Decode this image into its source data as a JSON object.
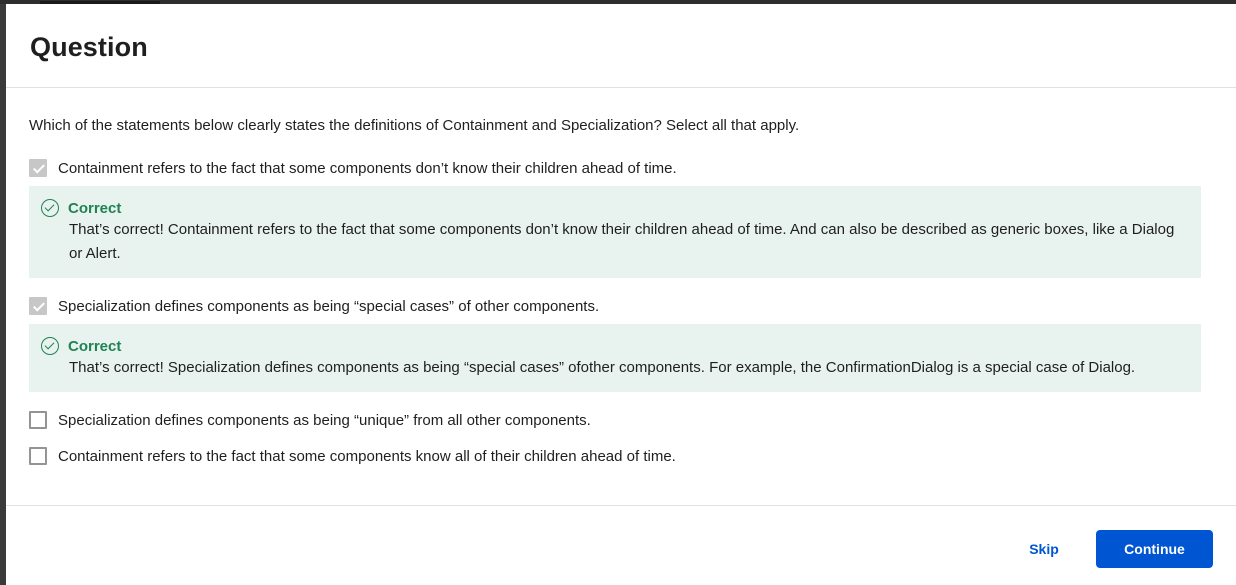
{
  "dialog": {
    "title": "Question",
    "prompt": "Which of the statements below clearly states the definitions of Containment and Specialization? Select all that apply.",
    "options": [
      {
        "label": "Containment refers to the fact that some components don’t know their children ahead of time.",
        "checked": true,
        "feedback": {
          "title": "Correct",
          "text": "That’s correct! Containment refers to the fact that some components don’t know their children ahead of time. And can also be described as generic boxes, like a Dialog or Alert."
        }
      },
      {
        "label": "Specialization defines components as being “special cases” of other components.",
        "checked": true,
        "feedback": {
          "title": "Correct",
          "text": "That’s correct! Specialization defines components as being “special cases” ofother components. For example, the ConfirmationDialog is a special case of Dialog."
        }
      },
      {
        "label": "Specialization defines components as being “unique” from all other components.",
        "checked": false
      },
      {
        "label": "Containment refers to the fact that some components know all of their children ahead of time.",
        "checked": false
      }
    ],
    "footer": {
      "skip_label": "Skip",
      "continue_label": "Continue"
    }
  },
  "icons": {
    "correct": "check-circle-icon",
    "checkbox_checked": "checkmark-icon"
  },
  "colors": {
    "accent": "#0056d2",
    "success": "#1f8354",
    "feedback_bg": "#e8f2ee",
    "checked_box": "#c7c7c7"
  }
}
